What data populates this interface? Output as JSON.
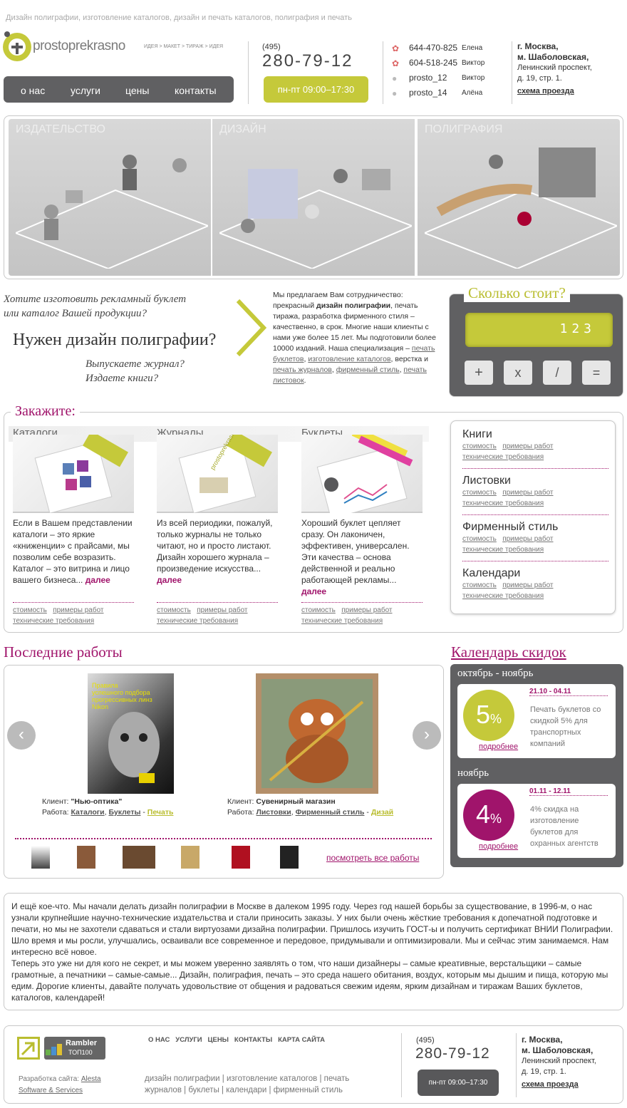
{
  "topline": "Дизайн полиграфии, изготовление каталогов, дизайн и печать каталогов, полиграфия и печать",
  "logo": {
    "name": "prostoprekrasno",
    "tagline": "ИДЕЯ > МАКЕТ > ТИРАЖ > ИДЕЯ"
  },
  "nav": [
    "о нас",
    "услуги",
    "цены",
    "контакты"
  ],
  "phone": {
    "code": "(495)",
    "number": "280-79-12",
    "hours": "пн-пт  09:00–17:30"
  },
  "contacts": [
    {
      "value": "644-470-825",
      "name": "Елена",
      "icon": "icq-icon"
    },
    {
      "value": "604-518-245",
      "name": "Виктор",
      "icon": "icq-icon"
    },
    {
      "value": "prosto_12",
      "name": "Виктор",
      "icon": "skype-icon"
    },
    {
      "value": "prosto_14",
      "name": "Алёна",
      "icon": "skype-icon"
    }
  ],
  "address": {
    "line1": "г. Москва,",
    "line2": "м. Шаболовская,",
    "line3": "Ленинский проспект,",
    "line4": "д. 19, стр. 1.",
    "map": "схема проезда"
  },
  "banner": [
    "ИЗДАТЕЛЬСТВО",
    "ДИЗАЙН",
    "ПОЛИГРАФИЯ"
  ],
  "intro": {
    "q1": "Хотите изготовить рекламный буклет",
    "q2": "или каталог Вашей продукции?",
    "headline": "Нужен дизайн полиграфии?",
    "q3": "Выпускаете журнал?",
    "q4": "Издаете книги?",
    "p_a": "Мы предлагаем Вам сотрудничество: прекрасный ",
    "p_b": "дизайн полиграфии",
    "p_c": ", печать тиража, разработка фирменного стиля – качественно, в срок. Многие наши клиенты с нами уже более 15 лет. Мы подготовили более 10000 изданий. Наша специализация – ",
    "l1": "печать буклетов",
    "l2": "изготовление каталогов",
    "p_d": "верстка и ",
    "l3": "печать журналов",
    "l4": "фирменный стиль",
    "l5": "печать листовок"
  },
  "calc": {
    "title": "Сколько стоит?",
    "display": "123",
    "buttons": [
      "+",
      "x",
      "/",
      "="
    ]
  },
  "order": {
    "title": "Закажите:",
    "cols": [
      {
        "title": "Каталоги",
        "text": "Если в Вашем представлении каталоги – это яркие «книженции» с прайсами, мы позволим себе возразить. Каталог – это витрина и лицо вашего бизнеса...",
        "more": "далее"
      },
      {
        "title": "Журналы",
        "text": "Из всей периодики, пожалуй, только журналы не только читают, но и просто листают. Дизайн хорошего журнала – произведение искусства...",
        "more": "далее"
      },
      {
        "title": "Буклеты",
        "text": "Хороший буклет цепляет сразу. Он лаконичен, эффективен, универсален. Эти качества – основа действенной и реально работающей рекламы...",
        "more": "далее"
      }
    ],
    "price": "стоимость",
    "examples": "примеры работ",
    "req": "технические требования",
    "side": [
      "Книги",
      "Листовки",
      "Фирменный стиль",
      "Календари"
    ]
  },
  "works": {
    "title": "Последние работы",
    "w1": {
      "cl": "Клиент: ",
      "client": "\"Нью-оптика\"",
      "wl": "Работа: ",
      "a": "Каталоги",
      "b": "Буклеты",
      "c": "Печать",
      "cover1": "Правила",
      "cover2": "успешного подбора",
      "cover3": "прогрессивных линз",
      "cover4": "Nikon"
    },
    "w2": {
      "cl": "Клиент: ",
      "client": "Сувенирный магазин",
      "wl": "Работа: ",
      "a": "Листовки",
      "b": "Фирменный стиль",
      "c": "Дизай"
    },
    "all": "посмотреть все работы"
  },
  "discounts": {
    "title": "Календарь скидок",
    "items": [
      {
        "period": "октябрь - ноябрь",
        "dates": "21.10 - 04.11",
        "pct": "5",
        "text": "Печать буклетов со скидкой 5% для транспортных компаний",
        "more": "подробнее"
      },
      {
        "period": "ноябрь",
        "dates": "01.11 - 12.11",
        "pct": "4",
        "text": "4% скидка на изготовление буклетов для охранных агентств",
        "more": "подробнее"
      }
    ]
  },
  "about": {
    "p1": "И ещё кое-что. Мы начали делать дизайн полиграфии в Москве в далеком 1995 году. Через год нашей борьбы за существование, в 1996-м, о нас узнали крупнейшие научно-технические издательства и стали приносить заказы. У них были очень жёсткие требования к допечатной подготовке и печати, но мы не захотели сдаваться и стали виртуозами дизайна полиграфии. Пришлось изучить ГОСТ-ы и получить сертификат ВНИИ Полиграфии. Шло время и мы росли, улучшались, осваивали все современное и передовое, придумывали и оптимизировали. Мы и сейчас этим занимаемся. Нам интересно всё новое.",
    "p2": "Теперь это уже ни для кого не секрет, и мы можем уверенно заявлять о том, что наши дизайнеры – самые креативные, верстальщики – самые грамотные, а печатники – самые-самые... Дизайн, полиграфия, печать – это среда нашего обитания, воздух, которым мы дышим и пища, которую мы едим. Дорогие клиенты, давайте получать удовольствие от общения и радоваться свежим идеям, ярким дизайнам и тиражам Ваших буклетов, каталогов, календарей!"
  },
  "footer": {
    "nav": [
      "О НАС",
      "УСЛУГИ",
      "ЦЕНЫ",
      "КОНТАКТЫ",
      "КАРТА САЙТА"
    ],
    "rambler1": "Rambler",
    "rambler2": "ТОП100",
    "dev_label": "Разработка сайта: ",
    "dev1": "Alesta",
    "dev2": "Software & Services",
    "links": [
      "дизайн полиграфии",
      "изготовление каталогов",
      "печать",
      "журналов",
      "буклеты",
      "календари",
      "фирменный стиль"
    ],
    "sep": " | "
  },
  "colors": {
    "accent": "#a0146b",
    "lime": "#c5c93a",
    "dark": "#58585a"
  }
}
